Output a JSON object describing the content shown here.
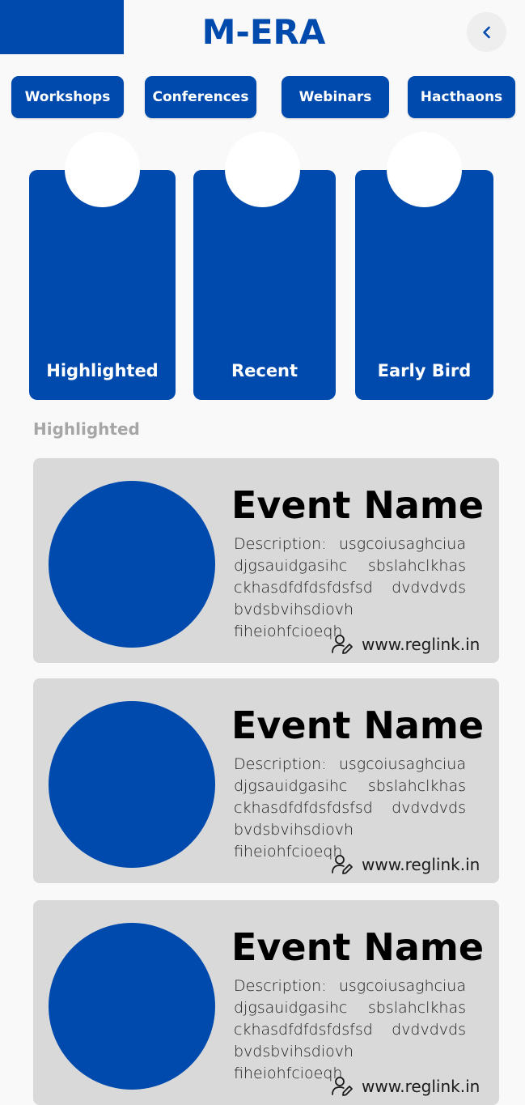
{
  "header": {
    "title": "M-ERA",
    "back_icon": "chevron-left-icon",
    "accent_color": "#004aad"
  },
  "categories": [
    {
      "label": "Workshops"
    },
    {
      "label": "Conferences"
    },
    {
      "label": "Webinars"
    },
    {
      "label": "Hacthaons"
    }
  ],
  "tiles": [
    {
      "label": "Highlighted"
    },
    {
      "label": "Recent"
    },
    {
      "label": "Early Bird"
    }
  ],
  "section": {
    "heading": "Highlighted"
  },
  "events": [
    {
      "name": "Event Name",
      "description": "Description: usgcoiusaghciua djgsauidgasihc sbslahclkhas ckhasdfdfdsfdsfsd dvdvdvds bvdsbvihsdiovh fiheiohfcioeqh",
      "link": "www.reglink.in",
      "link_icon": "user-edit-icon"
    },
    {
      "name": "Event Name",
      "description": "Description: usgcoiusaghciua djgsauidgasihc sbslahclkhas ckhasdfdfdsfdsfsd dvdvdvds bvdsbvihsdiovh fiheiohfcioeqh",
      "link": "www.reglink.in",
      "link_icon": "user-edit-icon"
    },
    {
      "name": "Event Name",
      "description": "Description: usgcoiusaghciua djgsauidgasihc sbslahclkhas ckhasdfdfdsfdsfsd dvdvdvds bvdsbvihsdiovh fiheiohfcioeqh",
      "link": "www.reglink.in",
      "link_icon": "user-edit-icon"
    }
  ]
}
